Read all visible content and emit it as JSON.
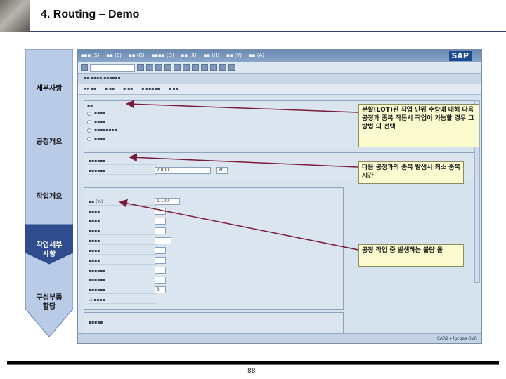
{
  "slide": {
    "title": "4. Routing – Demo",
    "page_number": "88"
  },
  "nav": {
    "items": [
      {
        "label": "세부사항",
        "active": false
      },
      {
        "label": "공정개요",
        "active": false
      },
      {
        "label": "작업개요",
        "active": false
      },
      {
        "label": "작업세부\n사항",
        "active": true
      },
      {
        "label": "구성부품\n할당",
        "active": false
      }
    ]
  },
  "sap": {
    "quantity_value": "2,000",
    "quantity_unit": "PC",
    "scrap_value": "1.100",
    "count_value": "3",
    "logo": "SAP",
    "status_text": "CAR2 ▸ lgcqas OVR"
  },
  "callouts": {
    "lot_split": "분할(LOT)된 작업 단위 수량에 대해 다음 공정과 중복 작동시 작업이 가능할 경우 그 방법 의 선택",
    "overlap_time": "다음 공정과의 중복 발생시 최소 중복 시간",
    "scrap": "공정 작업 중 발생하는 불량 율"
  },
  "colors": {
    "nav_fill": "#b9cbe6",
    "nav_active": "#2e4c8e",
    "callout_bg": "#fbfbd0",
    "arrow_color": "#7a1a3a"
  }
}
